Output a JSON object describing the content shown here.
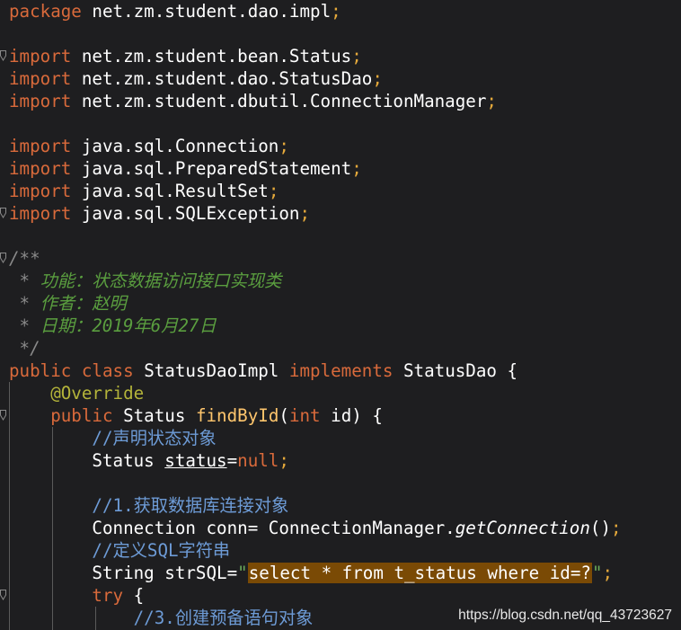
{
  "colors": {
    "background": "#1e1e20",
    "keyword": "#d96a3b",
    "plain": "#ffffff",
    "punct": "#e5a93b",
    "annotation": "#b4b43a",
    "method": "#ffc66d",
    "comment_gray": "#8a8a8a",
    "doc_green": "#5a9e3f",
    "line_comment": "#6d9bd6",
    "string": "#6aab5a",
    "string_highlight_bg": "#7a4a05",
    "guide": "#5a5a5a"
  },
  "code_lines": [
    {
      "tokens": [
        {
          "t": "package",
          "c": "keyword"
        },
        {
          "t": " net.zm.student.dao.impl",
          "c": "plain"
        },
        {
          "t": ";",
          "c": "punct"
        }
      ]
    },
    {
      "tokens": []
    },
    {
      "fold": true,
      "tokens": [
        {
          "t": "import",
          "c": "keyword"
        },
        {
          "t": " net.zm.student.bean.Status",
          "c": "plain"
        },
        {
          "t": ";",
          "c": "punct"
        }
      ]
    },
    {
      "tokens": [
        {
          "t": "import",
          "c": "keyword"
        },
        {
          "t": " net.zm.student.dao.StatusDao",
          "c": "plain"
        },
        {
          "t": ";",
          "c": "punct"
        }
      ]
    },
    {
      "tokens": [
        {
          "t": "import",
          "c": "keyword"
        },
        {
          "t": " net.zm.student.dbutil.ConnectionManager",
          "c": "plain"
        },
        {
          "t": ";",
          "c": "punct"
        }
      ]
    },
    {
      "tokens": []
    },
    {
      "tokens": [
        {
          "t": "import",
          "c": "keyword"
        },
        {
          "t": " java.sql.Connection",
          "c": "plain"
        },
        {
          "t": ";",
          "c": "punct"
        }
      ]
    },
    {
      "tokens": [
        {
          "t": "import",
          "c": "keyword"
        },
        {
          "t": " java.sql.PreparedStatement",
          "c": "plain"
        },
        {
          "t": ";",
          "c": "punct"
        }
      ]
    },
    {
      "tokens": [
        {
          "t": "import",
          "c": "keyword"
        },
        {
          "t": " java.sql.ResultSet",
          "c": "plain"
        },
        {
          "t": ";",
          "c": "punct"
        }
      ]
    },
    {
      "fold": true,
      "tokens": [
        {
          "t": "import",
          "c": "keyword"
        },
        {
          "t": " java.sql.SQLException",
          "c": "plain"
        },
        {
          "t": ";",
          "c": "punct"
        }
      ]
    },
    {
      "tokens": []
    },
    {
      "fold": true,
      "tokens": [
        {
          "t": "/**",
          "c": "comment_gray",
          "i": true
        }
      ]
    },
    {
      "tokens": [
        {
          "t": " * ",
          "c": "comment_gray",
          "i": true
        },
        {
          "t": "功能：状态数据访问接口实现类",
          "c": "doc_green",
          "i": true
        }
      ]
    },
    {
      "tokens": [
        {
          "t": " * ",
          "c": "comment_gray",
          "i": true
        },
        {
          "t": "作者：赵明",
          "c": "doc_green",
          "i": true
        }
      ]
    },
    {
      "tokens": [
        {
          "t": " * ",
          "c": "comment_gray",
          "i": true
        },
        {
          "t": "日期：2019年6月27日",
          "c": "doc_green",
          "i": true
        }
      ]
    },
    {
      "tokens": [
        {
          "t": " */",
          "c": "comment_gray",
          "i": true
        }
      ]
    },
    {
      "tokens": [
        {
          "t": "public ",
          "c": "keyword"
        },
        {
          "t": "class ",
          "c": "keyword"
        },
        {
          "t": "StatusDaoImpl ",
          "c": "plain"
        },
        {
          "t": "implements ",
          "c": "keyword"
        },
        {
          "t": "StatusDao {",
          "c": "plain"
        }
      ]
    },
    {
      "tokens": [
        {
          "t": "    @Override",
          "c": "annotation"
        }
      ]
    },
    {
      "fold": true,
      "tokens": [
        {
          "t": "    public ",
          "c": "keyword"
        },
        {
          "t": "Status ",
          "c": "plain"
        },
        {
          "t": "findById",
          "c": "method"
        },
        {
          "t": "(",
          "c": "plain"
        },
        {
          "t": "int ",
          "c": "keyword"
        },
        {
          "t": "id) {",
          "c": "plain"
        }
      ]
    },
    {
      "tokens": [
        {
          "t": "        //声明状态对象",
          "c": "line_comment"
        }
      ]
    },
    {
      "tokens": [
        {
          "t": "        Status ",
          "c": "plain"
        },
        {
          "t": "status",
          "c": "plain",
          "u": true
        },
        {
          "t": "=",
          "c": "plain"
        },
        {
          "t": "null",
          "c": "keyword"
        },
        {
          "t": ";",
          "c": "punct"
        }
      ]
    },
    {
      "tokens": []
    },
    {
      "tokens": [
        {
          "t": "        //1.获取数据库连接对象",
          "c": "line_comment"
        }
      ]
    },
    {
      "tokens": [
        {
          "t": "        Connection conn= ConnectionManager.",
          "c": "plain"
        },
        {
          "t": "getConnection",
          "c": "plain",
          "i": true
        },
        {
          "t": "()",
          "c": "plain"
        },
        {
          "t": ";",
          "c": "punct"
        }
      ]
    },
    {
      "tokens": [
        {
          "t": "        //定义SQL字符串",
          "c": "line_comment"
        }
      ]
    },
    {
      "tokens": [
        {
          "t": "        String strSQL=",
          "c": "plain"
        },
        {
          "t": "\"",
          "c": "string"
        },
        {
          "t": "select * from t_status where id=?",
          "c": "plain",
          "h": true
        },
        {
          "t": "\"",
          "c": "string"
        },
        {
          "t": ";",
          "c": "punct"
        }
      ]
    },
    {
      "fold": true,
      "tokens": [
        {
          "t": "        try ",
          "c": "keyword"
        },
        {
          "t": "{",
          "c": "plain"
        }
      ]
    },
    {
      "tokens": [
        {
          "t": "            //3.创建预备语句对象",
          "c": "line_comment"
        }
      ]
    }
  ],
  "watermark": "https://blog.csdn.net/qq_43723627"
}
